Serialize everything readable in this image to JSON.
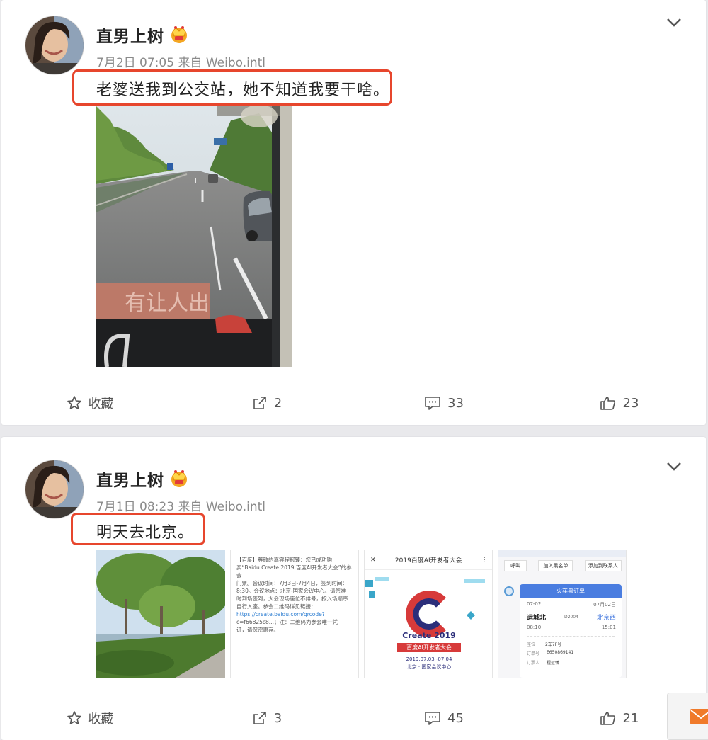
{
  "posts": [
    {
      "username": "直男上树",
      "vip_icon": "crown-badge-icon",
      "timestamp": "7月2日 07:05",
      "source_prefix": "来自",
      "source": "Weibo.intl",
      "text": "老婆送我到公交站，她不知道我要干啥。",
      "highlight_color": "#e7462d",
      "actions": {
        "favorite": "收藏",
        "repost_count": "2",
        "comment_count": "33",
        "like_count": "23"
      }
    },
    {
      "username": "直男上树",
      "vip_icon": "crown-badge-icon",
      "timestamp": "7月1日 08:23",
      "source_prefix": "来自",
      "source": "Weibo.intl",
      "text": "明天去北京。",
      "highlight_color": "#e7462d",
      "actions": {
        "favorite": "收藏",
        "repost_count": "3",
        "comment_count": "45",
        "like_count": "21"
      },
      "thumb_sms": {
        "line1": "【百度】尊敬的嘉宾程冠臻：您已成功购",
        "line2": "买“Baidu Create 2019 百度AI开发者大会”的参会",
        "line3": "门票。会议时间：7月3日-7月4日，签到时间：",
        "line4": "8:30。会议地点：北京-国家会议中心。请您准",
        "line5": "时到场签到，大会现场座位不排号，按入场顺序",
        "line6": "自行入座。参会二维码详见链接：",
        "link": "https://create.baidu.com/qrcode?",
        "line7": "c=f66825c8...；注：二维码为参会唯一凭",
        "line8": "证，请保密惠存。"
      },
      "thumb_event": {
        "close": "✕",
        "header": "2019百度AI开发者大会",
        "menu": "⋮",
        "brand": "Create 2019",
        "tagline": "百度AI开发者大会",
        "dates": "2019.07.03 -07.04",
        "venue": "北京 · 国家会议中心"
      },
      "thumb_ticket": {
        "btn_call": "呼叫",
        "btn_blacklist": "加入黑名单",
        "btn_contact": "添加到联系人",
        "title": "火车票订单",
        "date_left": "07-02",
        "date_right": "07月02日",
        "from": "运城北",
        "train": "D2004",
        "to": "北京西",
        "depart": "08:10",
        "arrive": "15:01",
        "seat_label": "座位",
        "seat_value": "2车7F号",
        "order_label": "订单号",
        "order_value": "E650869141",
        "person_label": "订票人",
        "person_value": "程冠臻"
      }
    }
  ]
}
